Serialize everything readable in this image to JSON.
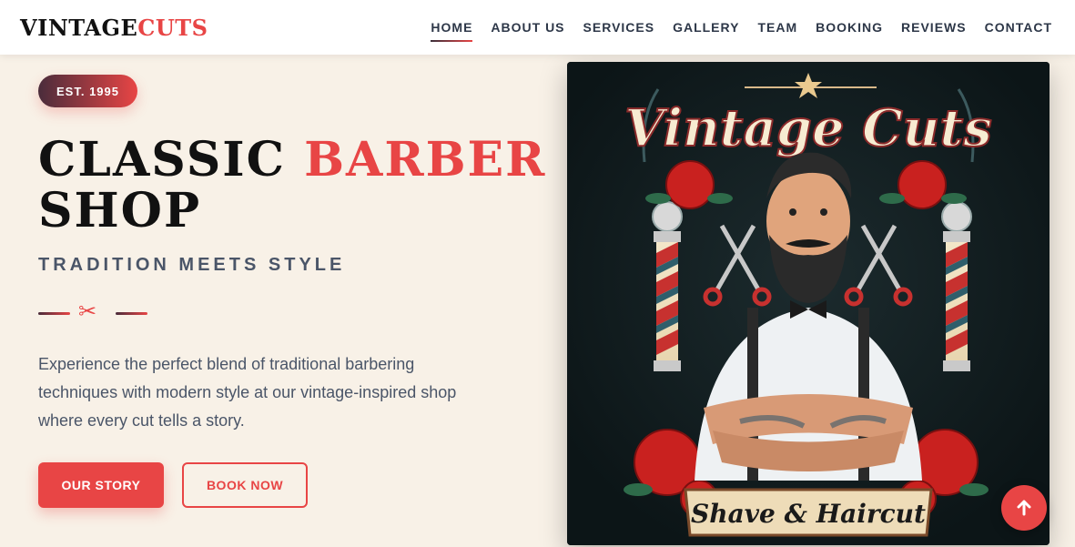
{
  "logo": {
    "part1": "VINTAGE",
    "part2": "CUTS"
  },
  "nav": {
    "items": [
      {
        "label": "HOME",
        "active": true
      },
      {
        "label": "ABOUT US"
      },
      {
        "label": "SERVICES"
      },
      {
        "label": "GALLERY"
      },
      {
        "label": "TEAM"
      },
      {
        "label": "BOOKING"
      },
      {
        "label": "REVIEWS"
      },
      {
        "label": "CONTACT"
      }
    ]
  },
  "hero": {
    "badge": "EST. 1995",
    "headline_part1": "CLASSIC ",
    "headline_accent": "BARBER",
    "headline_part2": "SHOP",
    "tagline": "TRADITION MEETS STYLE",
    "description": "Experience the perfect blend of traditional barbering techniques with modern style at our vintage-inspired shop where every cut tells a story.",
    "primary_button": "OUR STORY",
    "secondary_button": "BOOK NOW"
  },
  "poster": {
    "title": "Vintage Cuts",
    "banner": "Shave & Haircut"
  },
  "icons": {
    "divider": "scissors-icon",
    "back_to_top": "arrow-up-icon"
  },
  "colors": {
    "accent": "#e84545",
    "background": "#f8f1e7",
    "dark": "#111111"
  }
}
